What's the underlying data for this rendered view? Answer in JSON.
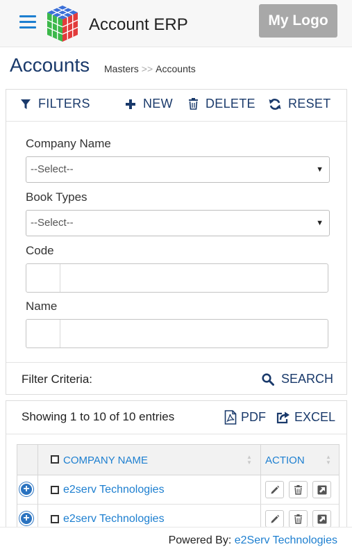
{
  "header": {
    "app_title": "Account ERP",
    "logo_label": "My Logo"
  },
  "page": {
    "title": "Accounts",
    "breadcrumb": [
      "Masters",
      ">>",
      "Accounts"
    ]
  },
  "toolbar": {
    "filters_label": "FILTERS",
    "new_label": "NEW",
    "delete_label": "DELETE",
    "reset_label": "RESET"
  },
  "filters": {
    "company_name": {
      "label": "Company Name",
      "value": "--Select--"
    },
    "book_types": {
      "label": "Book Types",
      "value": "--Select--"
    },
    "code": {
      "label": "Code",
      "value": ""
    },
    "name": {
      "label": "Name",
      "value": ""
    },
    "criteria_label": "Filter Criteria:",
    "search_label": "SEARCH"
  },
  "results": {
    "showing_text": "Showing 1 to 10 of 10 entries",
    "pdf_label": "PDF",
    "excel_label": "EXCEL",
    "columns": [
      "COMPANY NAME",
      "ACTION"
    ],
    "rows": [
      {
        "company_name": "e2serv Technologies"
      },
      {
        "company_name": "e2serv Technologies"
      }
    ]
  },
  "footer": {
    "powered_by": "Powered By:",
    "company": "e2Serv Technologies"
  },
  "colors": {
    "accent": "#1d7fd0",
    "title": "#1a3a6b",
    "logo_bg": "#a8a8a8"
  },
  "icons": [
    "menu-icon",
    "app-cube-icon",
    "filter-icon",
    "plus-icon",
    "trash-icon",
    "refresh-icon",
    "search-icon",
    "pdf-icon",
    "export-icon",
    "expand-icon",
    "edit-icon",
    "delete-icon",
    "open-icon"
  ]
}
